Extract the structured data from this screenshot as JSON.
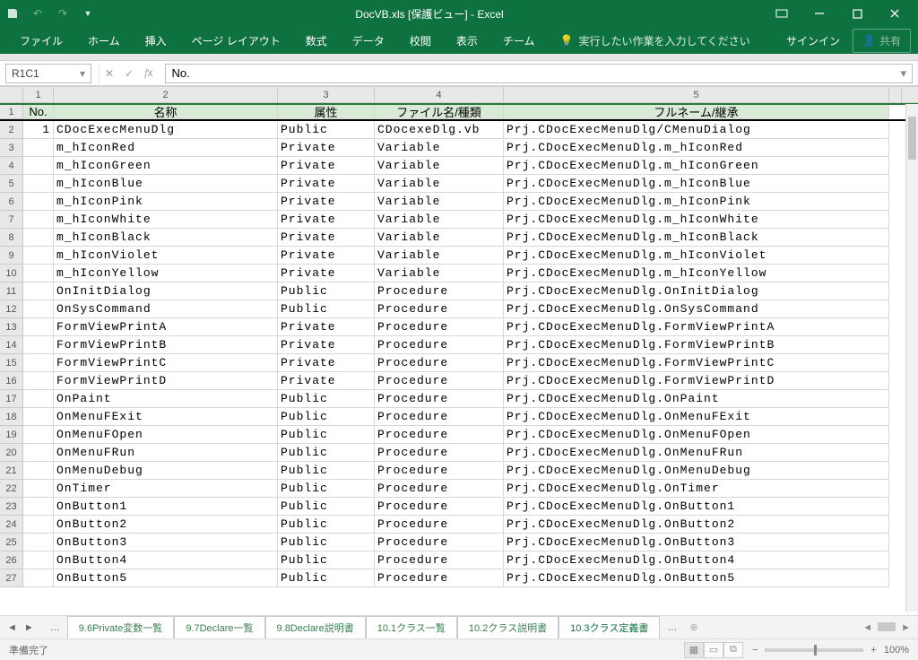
{
  "title": "DocVB.xls  [保護ビュー] - Excel",
  "ribbon": {
    "tabs": [
      "ファイル",
      "ホーム",
      "挿入",
      "ページ レイアウト",
      "数式",
      "データ",
      "校閲",
      "表示",
      "チーム"
    ],
    "tell": "実行したい作業を入力してください",
    "signin": "サインイン",
    "share": "共有"
  },
  "fx": {
    "name": "R1C1",
    "value": "No."
  },
  "colhdr": [
    "1",
    "2",
    "3",
    "4",
    "5"
  ],
  "headers": {
    "no": "No.",
    "name": "名称",
    "attr": "属性",
    "file": "ファイル名/種類",
    "full": "フルネーム/継承"
  },
  "rows": [
    {
      "no": "1",
      "name": "CDocExecMenuDlg",
      "attr": "Public",
      "file": "CDocexeDlg.vb",
      "full": "Prj.CDocExecMenuDlg/CMenuDialog"
    },
    {
      "no": "",
      "name": "m_hIconRed",
      "attr": "Private",
      "file": "Variable",
      "full": "Prj.CDocExecMenuDlg.m_hIconRed"
    },
    {
      "no": "",
      "name": "m_hIconGreen",
      "attr": "Private",
      "file": "Variable",
      "full": "Prj.CDocExecMenuDlg.m_hIconGreen"
    },
    {
      "no": "",
      "name": "m_hIconBlue",
      "attr": "Private",
      "file": "Variable",
      "full": "Prj.CDocExecMenuDlg.m_hIconBlue"
    },
    {
      "no": "",
      "name": "m_hIconPink",
      "attr": "Private",
      "file": "Variable",
      "full": "Prj.CDocExecMenuDlg.m_hIconPink"
    },
    {
      "no": "",
      "name": "m_hIconWhite",
      "attr": "Private",
      "file": "Variable",
      "full": "Prj.CDocExecMenuDlg.m_hIconWhite"
    },
    {
      "no": "",
      "name": "m_hIconBlack",
      "attr": "Private",
      "file": "Variable",
      "full": "Prj.CDocExecMenuDlg.m_hIconBlack"
    },
    {
      "no": "",
      "name": "m_hIconViolet",
      "attr": "Private",
      "file": "Variable",
      "full": "Prj.CDocExecMenuDlg.m_hIconViolet"
    },
    {
      "no": "",
      "name": "m_hIconYellow",
      "attr": "Private",
      "file": "Variable",
      "full": "Prj.CDocExecMenuDlg.m_hIconYellow"
    },
    {
      "no": "",
      "name": "OnInitDialog",
      "attr": "Public",
      "file": "Procedure",
      "full": "Prj.CDocExecMenuDlg.OnInitDialog"
    },
    {
      "no": "",
      "name": "OnSysCommand",
      "attr": "Public",
      "file": "Procedure",
      "full": "Prj.CDocExecMenuDlg.OnSysCommand"
    },
    {
      "no": "",
      "name": "FormViewPrintA",
      "attr": "Private",
      "file": "Procedure",
      "full": "Prj.CDocExecMenuDlg.FormViewPrintA"
    },
    {
      "no": "",
      "name": "FormViewPrintB",
      "attr": "Private",
      "file": "Procedure",
      "full": "Prj.CDocExecMenuDlg.FormViewPrintB"
    },
    {
      "no": "",
      "name": "FormViewPrintC",
      "attr": "Private",
      "file": "Procedure",
      "full": "Prj.CDocExecMenuDlg.FormViewPrintC"
    },
    {
      "no": "",
      "name": "FormViewPrintD",
      "attr": "Private",
      "file": "Procedure",
      "full": "Prj.CDocExecMenuDlg.FormViewPrintD"
    },
    {
      "no": "",
      "name": "OnPaint",
      "attr": "Public",
      "file": "Procedure",
      "full": "Prj.CDocExecMenuDlg.OnPaint"
    },
    {
      "no": "",
      "name": "OnMenuFExit",
      "attr": "Public",
      "file": "Procedure",
      "full": "Prj.CDocExecMenuDlg.OnMenuFExit"
    },
    {
      "no": "",
      "name": "OnMenuFOpen",
      "attr": "Public",
      "file": "Procedure",
      "full": "Prj.CDocExecMenuDlg.OnMenuFOpen"
    },
    {
      "no": "",
      "name": "OnMenuFRun",
      "attr": "Public",
      "file": "Procedure",
      "full": "Prj.CDocExecMenuDlg.OnMenuFRun"
    },
    {
      "no": "",
      "name": "OnMenuDebug",
      "attr": "Public",
      "file": "Procedure",
      "full": "Prj.CDocExecMenuDlg.OnMenuDebug"
    },
    {
      "no": "",
      "name": "OnTimer",
      "attr": "Public",
      "file": "Procedure",
      "full": "Prj.CDocExecMenuDlg.OnTimer"
    },
    {
      "no": "",
      "name": "OnButton1",
      "attr": "Public",
      "file": "Procedure",
      "full": "Prj.CDocExecMenuDlg.OnButton1"
    },
    {
      "no": "",
      "name": "OnButton2",
      "attr": "Public",
      "file": "Procedure",
      "full": "Prj.CDocExecMenuDlg.OnButton2"
    },
    {
      "no": "",
      "name": "OnButton3",
      "attr": "Public",
      "file": "Procedure",
      "full": "Prj.CDocExecMenuDlg.OnButton3"
    },
    {
      "no": "",
      "name": "OnButton4",
      "attr": "Public",
      "file": "Procedure",
      "full": "Prj.CDocExecMenuDlg.OnButton4"
    },
    {
      "no": "",
      "name": "OnButton5",
      "attr": "Public",
      "file": "Procedure",
      "full": "Prj.CDocExecMenuDlg.OnButton5"
    }
  ],
  "sheettabs": [
    "9.6Private変数一覧",
    "9.7Declare一覧",
    "9.8Declare説明書",
    "10.1クラス一覧",
    "10.2クラス説明書",
    "10.3クラス定義書"
  ],
  "activeTab": 5,
  "status": {
    "ready": "準備完了",
    "zoom": "100%"
  }
}
